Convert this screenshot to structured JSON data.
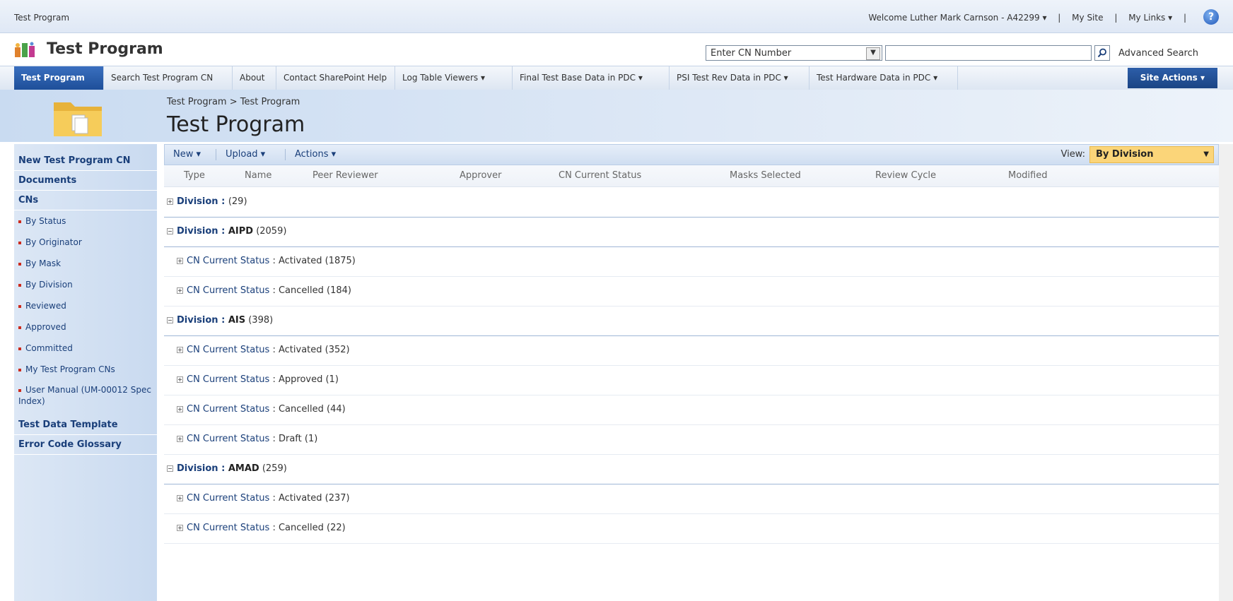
{
  "topbar": {
    "site_name": "Test Program",
    "welcome": "Welcome Luther Mark Carnson - A42299 ▾",
    "my_site": "My Site",
    "my_links": "My Links ▾",
    "sep": "|"
  },
  "header": {
    "site_title": "Test Program",
    "search_scope": "Enter CN Number",
    "search_value": "",
    "advanced_search": "Advanced Search"
  },
  "nav": {
    "tabs": [
      "Test Program",
      "Search Test Program CN",
      "About",
      "Contact SharePoint Help",
      "Log Table Viewers ▾",
      "Final Test Base Data in PDC ▾",
      "PSI Test Rev Data in PDC ▾",
      "Test Hardware Data in PDC ▾"
    ],
    "site_actions": "Site Actions ▾"
  },
  "page": {
    "breadcrumb": "Test Program > Test Program",
    "title": "Test Program"
  },
  "leftnav": {
    "sections": [
      "New Test Program CN",
      "Documents",
      "CNs"
    ],
    "cn_items": [
      "By Status",
      "By Originator",
      "By Mask",
      "By Division",
      "Reviewed",
      "Approved",
      "Committed",
      "My Test Program CNs",
      "User Manual (UM-00012 Spec Index)"
    ],
    "bottom_sections": [
      "Test Data Template",
      "Error Code Glossary"
    ]
  },
  "toolbar": {
    "new": "New ▾",
    "upload": "Upload ▾",
    "actions": "Actions ▾",
    "view_label": "View:",
    "view_value": "By Division"
  },
  "columns": [
    "Type",
    "Name",
    "Peer Reviewer",
    "Approver",
    "CN Current Status",
    "Masks Selected",
    "Review Cycle",
    "Modified"
  ],
  "rows": [
    {
      "field": "Division",
      "sep": " : ",
      "value": "",
      "count": "(29)"
    },
    {
      "field": "Division",
      "sep": " : ",
      "value": "AIPD",
      "count": "(2059)"
    },
    {
      "field": "CN Current Status",
      "sep": " : ",
      "value": "Activated",
      "count": "(1875)"
    },
    {
      "field": "CN Current Status",
      "sep": " : ",
      "value": "Cancelled",
      "count": "(184)"
    },
    {
      "field": "Division",
      "sep": " : ",
      "value": "AIS",
      "count": "(398)"
    },
    {
      "field": "CN Current Status",
      "sep": " : ",
      "value": "Activated",
      "count": "(352)"
    },
    {
      "field": "CN Current Status",
      "sep": " : ",
      "value": "Approved",
      "count": "(1)"
    },
    {
      "field": "CN Current Status",
      "sep": " : ",
      "value": "Cancelled",
      "count": "(44)"
    },
    {
      "field": "CN Current Status",
      "sep": " : ",
      "value": "Draft",
      "count": "(1)"
    },
    {
      "field": "Division",
      "sep": " : ",
      "value": "AMAD",
      "count": "(259)"
    },
    {
      "field": "CN Current Status",
      "sep": " : ",
      "value": "Activated",
      "count": "(237)"
    },
    {
      "field": "CN Current Status",
      "sep": " : ",
      "value": "Cancelled",
      "count": "(22)"
    }
  ],
  "colors": {
    "accent": "#1e4f99",
    "link": "#1a3f7a",
    "view_select": "#fbd579",
    "bullet": "#cc2b1d"
  }
}
